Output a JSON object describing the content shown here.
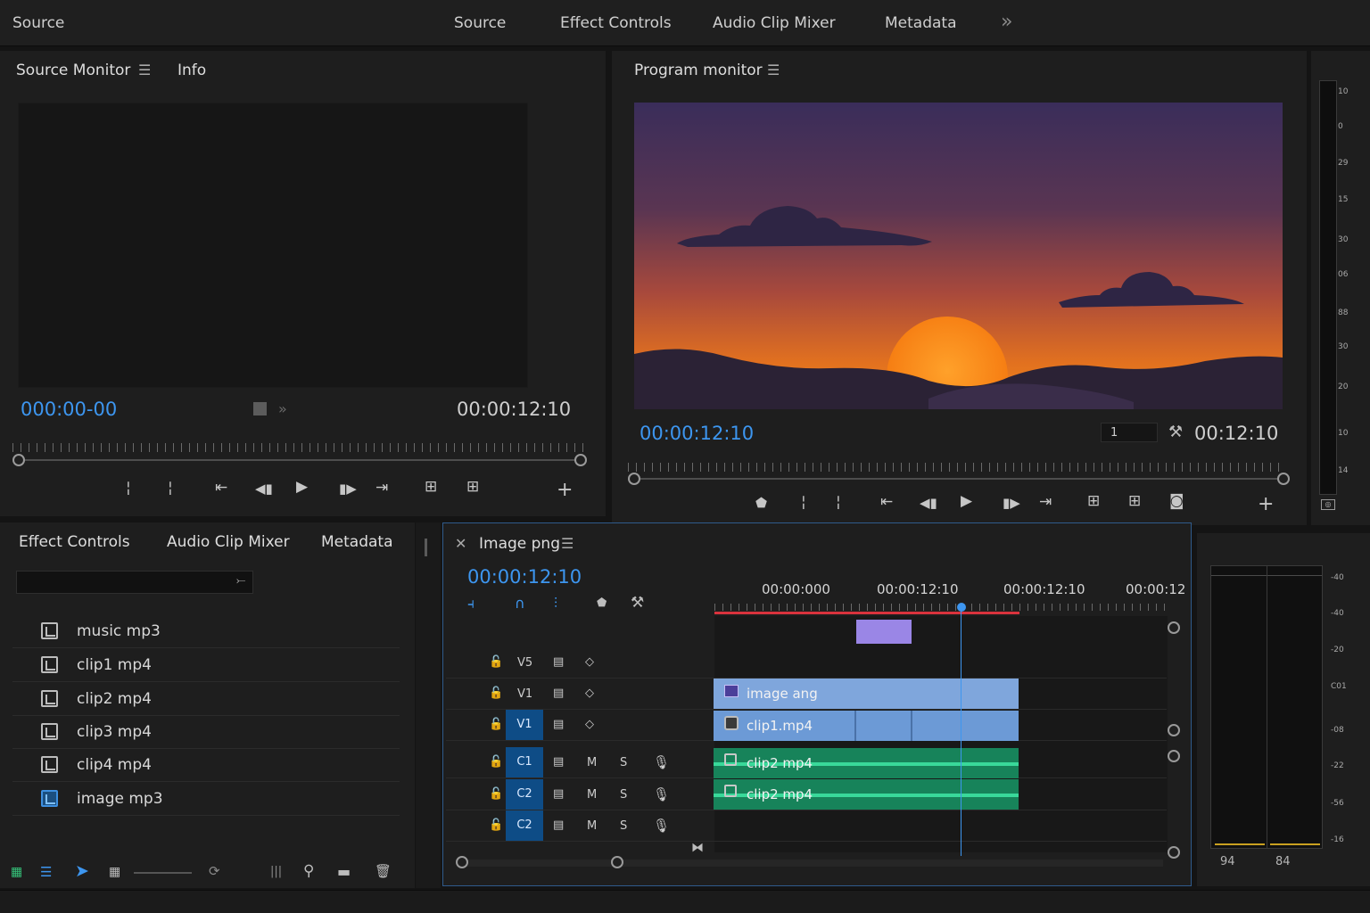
{
  "workspaces": {
    "left": "Source",
    "tabs": [
      "Source",
      "Effect Controls",
      "Audio Clip Mixer",
      "Metadata"
    ]
  },
  "source_monitor": {
    "title": "Source Monitor",
    "tab2": "Info",
    "timecode_in": "000:00-00",
    "timecode_out": "00:00:12:10"
  },
  "program_monitor": {
    "title": "Program monitor",
    "timecode": "00:00:12:10",
    "zoom_value": "1",
    "duration": "00:12:10"
  },
  "audio_meter_top": {
    "labels": [
      "10",
      "0",
      "29",
      "15",
      "30",
      "06",
      "88",
      "30",
      "20",
      "10",
      "14"
    ]
  },
  "effects_panel": {
    "tabs": [
      "Effect Controls",
      "Audio Clip Mixer",
      "Metadata"
    ],
    "items": [
      {
        "name": "music mp3",
        "icon": "clip-file-icon"
      },
      {
        "name": "clip1 mp4",
        "icon": "clip-file-icon"
      },
      {
        "name": "clip2 mp4",
        "icon": "clip-file-icon"
      },
      {
        "name": "clip3 mp4",
        "icon": "clip-file-icon"
      },
      {
        "name": "clip4 mp4",
        "icon": "clip-file-icon"
      },
      {
        "name": "image mp3",
        "icon": "image-file-icon"
      }
    ]
  },
  "timeline": {
    "sequence_name": "Image png",
    "timecode": "00:00:12:10",
    "ruler_labels": [
      "00:00:000",
      "00:00:12:10",
      "00:00:12:10",
      "00:00:12"
    ],
    "tracks": [
      {
        "label": "V5",
        "targeted": false
      },
      {
        "label": "V1",
        "targeted": false
      },
      {
        "label": "V1",
        "targeted": true
      },
      {
        "label": "C1",
        "targeted": true,
        "audio": true
      },
      {
        "label": "C2",
        "targeted": true,
        "audio": true
      },
      {
        "label": "C2",
        "targeted": true,
        "audio": true
      }
    ],
    "audio_buttons": {
      "mute": "M",
      "solo": "S"
    },
    "clips": {
      "image": "image ang",
      "clip1": "clip1.mp4",
      "audio1": "clip2 mp4",
      "audio2": "clip2 mp4"
    }
  },
  "audio_meter_right": {
    "labels": [
      "-40",
      "-40",
      "-20",
      "C01",
      "-08",
      "-22",
      "-56",
      "-16"
    ],
    "readouts": [
      "94",
      "84"
    ]
  },
  "colors": {
    "accent_blue": "#3d96f0",
    "clip_video": "#7fa6dc",
    "clip_audio": "#17835a",
    "clip_purple": "#9a86e6",
    "playhead": "#3d96f0",
    "work_area": "#d9333d"
  }
}
